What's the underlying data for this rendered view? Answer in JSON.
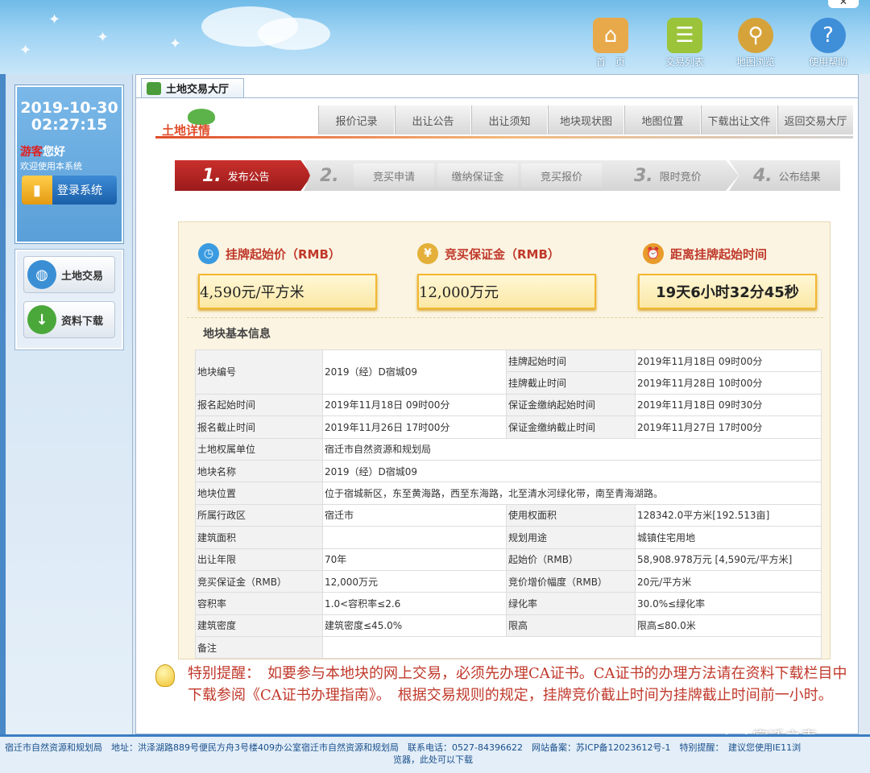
{
  "header": {
    "nav": [
      {
        "label": "首　页",
        "icon": "home-icon"
      },
      {
        "label": "交易列表",
        "icon": "list-icon"
      },
      {
        "label": "地图浏览",
        "icon": "map-icon"
      },
      {
        "label": "使用帮助",
        "icon": "help-icon"
      }
    ],
    "close_glyph": "✕"
  },
  "sidebar": {
    "date": "2019-10-30",
    "time": "02:27:15",
    "guest": "游客",
    "hello": "您好",
    "welcome": "欢迎使用本系统",
    "login": "登录系统",
    "menu": [
      {
        "label": "土地交易",
        "icon": "globe-icon"
      },
      {
        "label": "资料下载",
        "icon": "download-icon"
      }
    ]
  },
  "main": {
    "tab": "土地交易大厅",
    "logo_text": "土地详情",
    "subtabs": [
      "报价记录",
      "出让公告",
      "出让须知",
      "地块现状图",
      "地图位置",
      "下载出让文件",
      "返回交易大厅"
    ],
    "steps": [
      {
        "num": "1.",
        "label": "发布公告"
      },
      {
        "num": "2.",
        "label": ""
      },
      {
        "num": "3.",
        "label": "限时竞价"
      },
      {
        "num": "4.",
        "label": "公布结果"
      }
    ],
    "substeps": [
      "竞买申请",
      "缴纳保证金",
      "竞买报价"
    ],
    "prices": {
      "start_label": "挂牌起始价（RMB）",
      "start_value": "4,590元/平方米",
      "deposit_label": "竞买保证金（RMB）",
      "deposit_value": "12,000万元",
      "countdown_label": "距离挂牌起始时间",
      "countdown_value": "19天6小时32分45秒"
    },
    "basic_title": "地块基本信息",
    "table": {
      "r1": {
        "k": "地块编号",
        "v": "2019（经）D宿城09",
        "k2a": "挂牌起始时间",
        "v2a": "2019年11月18日 09时00分",
        "k2b": "挂牌截止时间",
        "v2b": "2019年11月28日 10时00分"
      },
      "r2": {
        "k": "报名起始时间",
        "v": "2019年11月18日 09时00分",
        "k2": "保证金缴纳起始时间",
        "v2": "2019年11月18日 09时30分"
      },
      "r3": {
        "k": "报名截止时间",
        "v": "2019年11月26日 17时00分",
        "k2": "保证金缴纳截止时间",
        "v2": "2019年11月27日 17时00分"
      },
      "r4": {
        "k": "土地权属单位",
        "v": "宿迁市自然资源和规划局"
      },
      "r5": {
        "k": "地块名称",
        "v": "2019（经）D宿城09"
      },
      "r6": {
        "k": "地块位置",
        "v": "位于宿城新区，东至黄海路，西至东海路，北至清水河绿化带，南至青海湖路。"
      },
      "r7": {
        "k": "所属行政区",
        "v": "宿迁市",
        "k2": "使用权面积",
        "v2": "128342.0平方米[192.513亩]"
      },
      "r8": {
        "k": "建筑面积",
        "v": "",
        "k2": "规划用途",
        "v2": "城镇住宅用地"
      },
      "r9": {
        "k": "出让年限",
        "v": "70年",
        "k2": "起始价（RMB）",
        "v2": "58,908.978万元 [4,590元/平方米]"
      },
      "r10": {
        "k": "竞买保证金（RMB）",
        "v": "12,000万元",
        "k2": "竞价增价幅度（RMB）",
        "v2": "20元/平方米"
      },
      "r11": {
        "k": "容积率",
        "v": "1.0<容积率≤2.6",
        "k2": "绿化率",
        "v2": "30.0%≤绿化率"
      },
      "r12": {
        "k": "建筑密度",
        "v": "建筑密度≤45.0%",
        "k2": "限高",
        "v2": "限高≤80.0米"
      },
      "r13": {
        "k": "备注",
        "v": ""
      }
    },
    "tip": "特别提醒：　如要参与本地块的网上交易，必须先办理CA证书。CA证书的办理方法请在资料下载栏目中下载参阅《CA证书办理指南》。　根据交易规则的规定，挂牌竞价截止时间为挂牌截止时间前一小时。"
  },
  "watermark": "宿迁之声",
  "footer": {
    "line1": "宿迁市自然资源和规划局　地址：洪泽湖路889号便民方舟3号楼409办公室宿迁市自然资源和规划局　联系电话：0527-84396622　网站备案：苏ICP备12023612号-1　特别提醒：　建议您使用IE11浏",
    "line2": "览器，此处可以下载"
  },
  "colors": {
    "accent_red": "#c9302c",
    "brand_blue": "#3b7dc2",
    "highlight_gold": "#f2b733"
  }
}
